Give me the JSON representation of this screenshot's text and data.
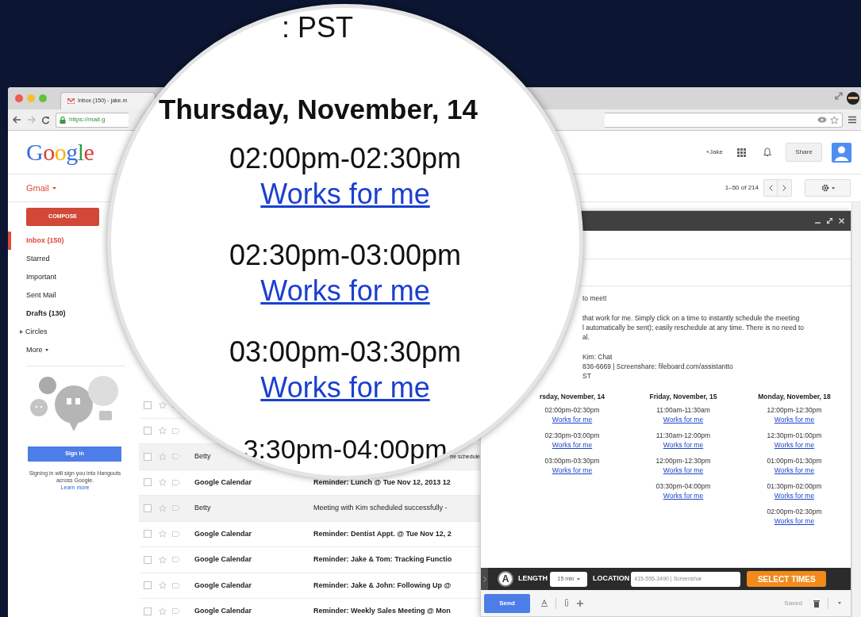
{
  "browser": {
    "tab_title": "Inbox (150) - jake.m",
    "url": "https://mail.g"
  },
  "gmail": {
    "logo": "Google",
    "mail_menu": "Gmail",
    "account": "+Jake",
    "share": "Share",
    "pagination": "1–50 of 214",
    "compose": "COMPOSE",
    "nav": [
      {
        "label": "Inbox (150)",
        "kind": "folder",
        "selected": true,
        "unread": true
      },
      {
        "label": "Starred",
        "kind": "folder",
        "selected": false,
        "unread": false
      },
      {
        "label": "Important",
        "kind": "folder",
        "selected": false,
        "unread": false
      },
      {
        "label": "Sent Mail",
        "kind": "folder",
        "selected": false,
        "unread": false
      },
      {
        "label": "Drafts (130)",
        "kind": "folder",
        "selected": false,
        "unread": true
      },
      {
        "label": "Circles",
        "kind": "group",
        "selected": false,
        "unread": false
      },
      {
        "label": "More",
        "kind": "menu",
        "selected": false,
        "unread": false
      }
    ],
    "hangouts": {
      "sign_in": "Sign in",
      "note": "Signing in will sign you into Hangouts across Google.",
      "learn_more": "Learn more"
    },
    "rows": [
      {
        "kind": "blank",
        "checked": false
      },
      {
        "kind": "blank",
        "checked": false
      },
      {
        "sender": "Betty",
        "subject": "be schedule",
        "read": true,
        "kind": "covered",
        "checked": false
      },
      {
        "sender": "Google Calendar",
        "subject": "Reminder: Lunch @ Tue Nov 12, 2013 12",
        "read": false,
        "kind": "mail",
        "checked": false
      },
      {
        "sender": "Betty",
        "subject": "Meeting with Kim scheduled successfully -",
        "read": true,
        "kind": "mail",
        "checked": false
      },
      {
        "sender": "Google Calendar",
        "subject": "Reminder: Dentist Appt. @ Tue Nov 12, 2",
        "read": false,
        "kind": "mail",
        "checked": false
      },
      {
        "sender": "Google Calendar",
        "subject": "Reminder: Jake & Tom: Tracking Functio",
        "read": false,
        "kind": "mail",
        "checked": false
      },
      {
        "sender": "Google Calendar",
        "subject": "Reminder: Jake & John: Following Up @",
        "read": false,
        "kind": "mail",
        "checked": false
      },
      {
        "sender": "Google Calendar",
        "subject": "Reminder: Weekly Sales Meeting @ Mon",
        "read": false,
        "kind": "mail",
        "checked": false
      }
    ]
  },
  "compose": {
    "paragraphs": [
      {
        "lines": [
          "to meet!"
        ]
      },
      {
        "lines": [
          "that work for me. Simply click on a time to instantly schedule the meeting",
          "l automatically be sent); easily reschedule at any time. There is no need to",
          "al."
        ]
      },
      {
        "lines": [
          "Kim: Chat",
          "836-6669 | Screenshare: fileboard.com/assistantto",
          "ST"
        ]
      }
    ],
    "columns": [
      {
        "day": "rsday, November, 14",
        "slots": [
          {
            "time": "02:00pm-02:30pm",
            "link": "Works for me"
          },
          {
            "time": "02:30pm-03:00pm",
            "link": "Works for me"
          },
          {
            "time": "03:00pm-03:30pm",
            "link": "Works for me"
          }
        ]
      },
      {
        "day": "Friday, November, 15",
        "slots": [
          {
            "time": "11:00am-11:30am",
            "link": "Works for me"
          },
          {
            "time": "11:30am-12:00pm",
            "link": "Works for me"
          },
          {
            "time": "12:00pm-12:30pm",
            "link": "Works for me"
          },
          {
            "time": "03:30pm-04:00pm",
            "link": "Works for me"
          }
        ]
      },
      {
        "day": "Monday, November, 18",
        "slots": [
          {
            "time": "12:00pm-12:30pm",
            "link": "Works for me"
          },
          {
            "time": "12:30pm-01:00pm",
            "link": "Works for me"
          },
          {
            "time": "01:00pm-01:30pm",
            "link": "Works for me"
          },
          {
            "time": "01:30pm-02:00pm",
            "link": "Works for me"
          },
          {
            "time": "02:00pm-02:30pm",
            "link": "Works for me"
          }
        ]
      }
    ],
    "toolbar": {
      "logo_letter": "A",
      "length_label": "LENGTH",
      "length": "15 min",
      "location_label": "LOCATION",
      "location": "415-555-3490 | Screenshar",
      "select_times": "SELECT TIMES"
    },
    "send": "Send",
    "saved": "Saved"
  },
  "magnifier": {
    "timezone": ": PST",
    "day": "Thursday, November, 14",
    "slots": [
      {
        "time": "02:00pm-02:30pm",
        "link": "Works for me"
      },
      {
        "time": "02:30pm-03:00pm",
        "link": "Works for me"
      },
      {
        "time": "03:00pm-03:30pm",
        "link": "Works for me"
      }
    ],
    "cut_time": "3:30pm-04:00pm"
  }
}
